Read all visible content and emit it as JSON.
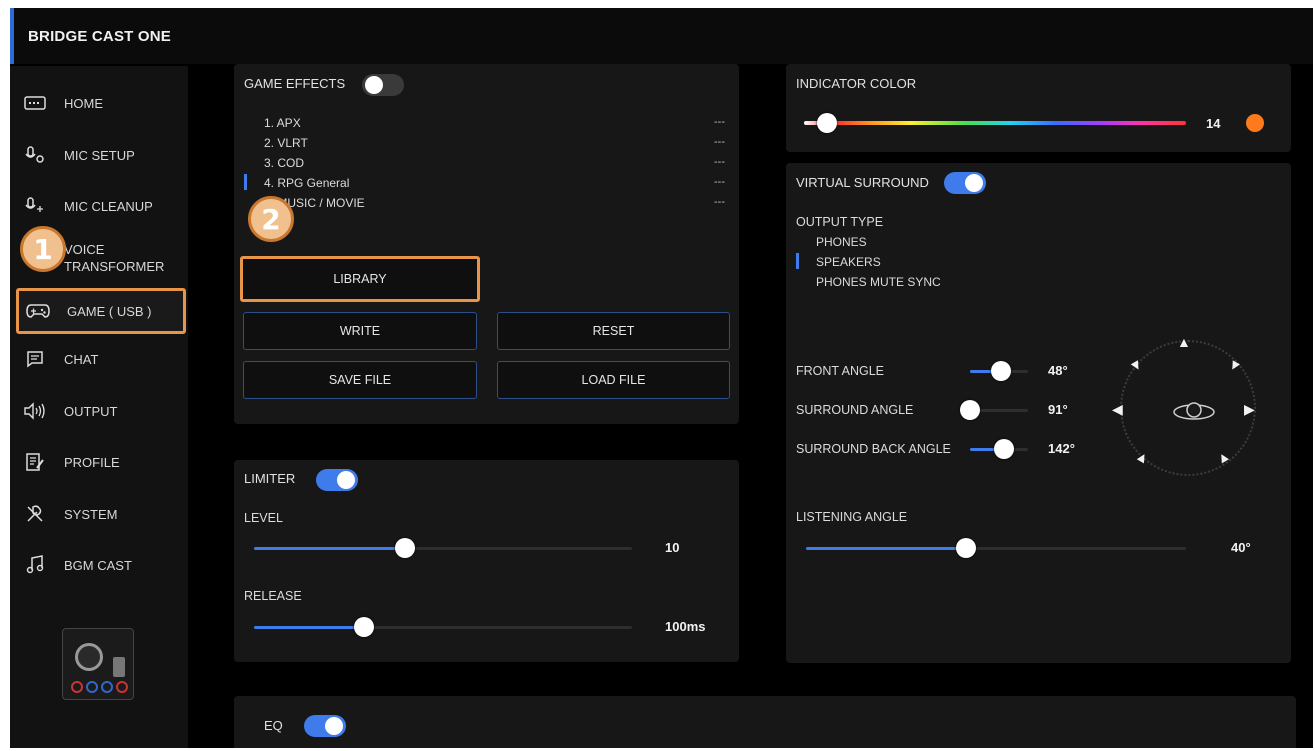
{
  "app": {
    "title": "BRIDGE CAST ONE"
  },
  "sidebar": {
    "items": [
      {
        "label": "HOME",
        "icon": "home-icon"
      },
      {
        "label": "MIC SETUP",
        "icon": "mic-setup-icon"
      },
      {
        "label": "MIC CLEANUP",
        "icon": "mic-cleanup-icon"
      },
      {
        "label": "VOICE\nTRANSFORMER",
        "icon": "voice-transformer-icon"
      },
      {
        "label": "GAME ( USB )",
        "icon": "gamepad-icon",
        "active": true
      },
      {
        "label": "CHAT",
        "icon": "chat-icon"
      },
      {
        "label": "OUTPUT",
        "icon": "speaker-icon"
      },
      {
        "label": "PROFILE",
        "icon": "profile-icon"
      },
      {
        "label": "SYSTEM",
        "icon": "wrench-icon"
      },
      {
        "label": "BGM CAST",
        "icon": "music-note-icon"
      }
    ],
    "callout": "1"
  },
  "game_effects": {
    "title": "GAME EFFECTS",
    "enabled": false,
    "presets": [
      {
        "label": "1. APX",
        "value": "---"
      },
      {
        "label": "2. VLRT",
        "value": "---"
      },
      {
        "label": "3. COD",
        "value": "---"
      },
      {
        "label": "4. RPG General",
        "value": "---",
        "selected": true
      },
      {
        "label": "5. MUSIC / MOVIE",
        "value": "---"
      }
    ],
    "callout": "2",
    "library_label": "LIBRARY",
    "write_label": "WRITE",
    "reset_label": "RESET",
    "save_file_label": "SAVE FILE",
    "load_file_label": "LOAD FILE"
  },
  "limiter": {
    "title": "LIMITER",
    "enabled": true,
    "level_label": "LEVEL",
    "level_value": "10",
    "level_fraction": 0.4,
    "release_label": "RELEASE",
    "release_value": "100ms",
    "release_fraction": 0.29
  },
  "indicator_color": {
    "title": "INDICATOR COLOR",
    "value": "14",
    "fraction": 0.06,
    "swatch": "#ff7a1a"
  },
  "virtual_surround": {
    "title": "VIRTUAL SURROUND",
    "enabled": true,
    "output_type_label": "OUTPUT TYPE",
    "output_types": [
      {
        "label": "PHONES"
      },
      {
        "label": "SPEAKERS",
        "selected": true
      },
      {
        "label": "PHONES MUTE SYNC"
      }
    ],
    "front_angle_label": "FRONT ANGLE",
    "front_angle_value": "48°",
    "front_angle_fraction": 0.53,
    "surround_angle_label": "SURROUND ANGLE",
    "surround_angle_value": "91°",
    "surround_angle_fraction": 0.0,
    "surround_back_angle_label": "SURROUND BACK ANGLE",
    "surround_back_angle_value": "142°",
    "surround_back_angle_fraction": 0.58,
    "listening_angle_label": "LISTENING ANGLE",
    "listening_angle_value": "40°",
    "listening_angle_fraction": 0.42
  },
  "eq": {
    "title": "EQ",
    "enabled": true
  },
  "colors": {
    "accent": "#3f7bea",
    "highlight": "#e8954a",
    "background": "#000000",
    "panel": "#171717"
  }
}
